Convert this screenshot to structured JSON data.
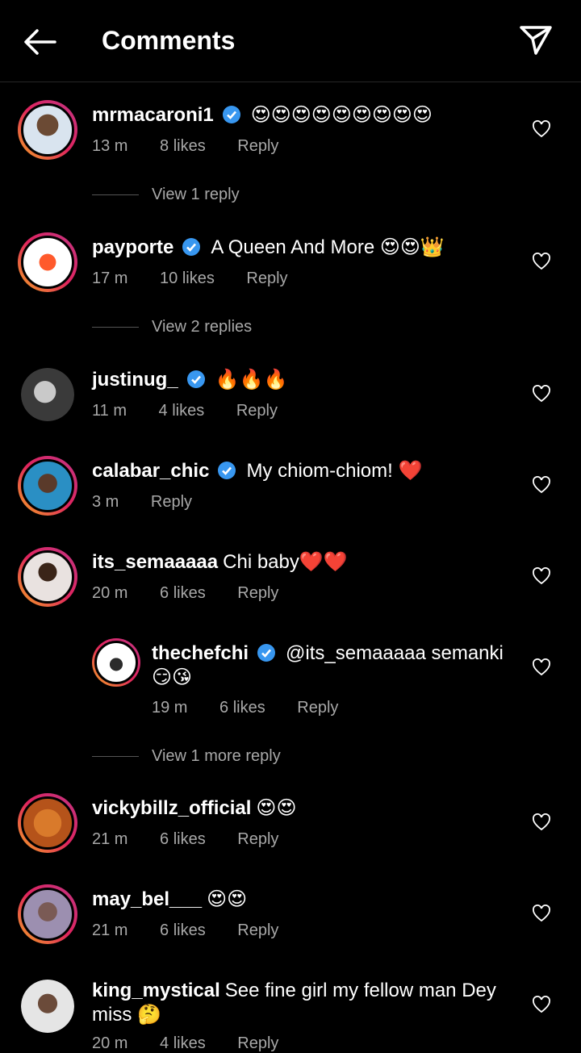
{
  "header": {
    "title": "Comments"
  },
  "comments": [
    {
      "user": "mrmacaroni1",
      "verified": true,
      "text": "😍😍😍😍😍😍😍😍😍",
      "time": "13 m",
      "likes": "8 likes",
      "reply": "Reply",
      "view_replies": "View 1 reply"
    },
    {
      "user": "payporte",
      "verified": true,
      "text": "A Queen And More 😍😍👑",
      "time": "17 m",
      "likes": "10 likes",
      "reply": "Reply",
      "view_replies": "View 2 replies"
    },
    {
      "user": "justinug_",
      "verified": true,
      "text": "🔥🔥🔥",
      "time": "11 m",
      "likes": "4 likes",
      "reply": "Reply"
    },
    {
      "user": "calabar_chic",
      "verified": true,
      "text": "My chiom-chiom! ❤️",
      "time": "3 m",
      "likes": "",
      "reply": "Reply"
    },
    {
      "user": "its_semaaaaa",
      "verified": false,
      "text": "Chi baby❤️❤️",
      "time": "20 m",
      "likes": "6 likes",
      "reply": "Reply"
    },
    {
      "user": "thechefchi",
      "verified": true,
      "text": "@its_semaaaaa semanki 😏😘",
      "time": "19 m",
      "likes": "6 likes",
      "reply": "Reply",
      "view_replies": "View 1 more reply"
    },
    {
      "user": "vickybillz_official",
      "verified": false,
      "text": "😍😍",
      "time": "21 m",
      "likes": "6 likes",
      "reply": "Reply"
    },
    {
      "user": "may_bel___",
      "verified": false,
      "text": "😍😍",
      "time": "21 m",
      "likes": "6 likes",
      "reply": "Reply"
    },
    {
      "user": "king_mystical",
      "verified": false,
      "text": "See fine girl my fellow man Dey miss 🤔",
      "time": "20 m",
      "likes": "4 likes",
      "reply": "Reply"
    }
  ],
  "colors": {
    "accent_blue": "#3897f0",
    "meta_gray": "#a8a8a8",
    "background": "#000000"
  }
}
